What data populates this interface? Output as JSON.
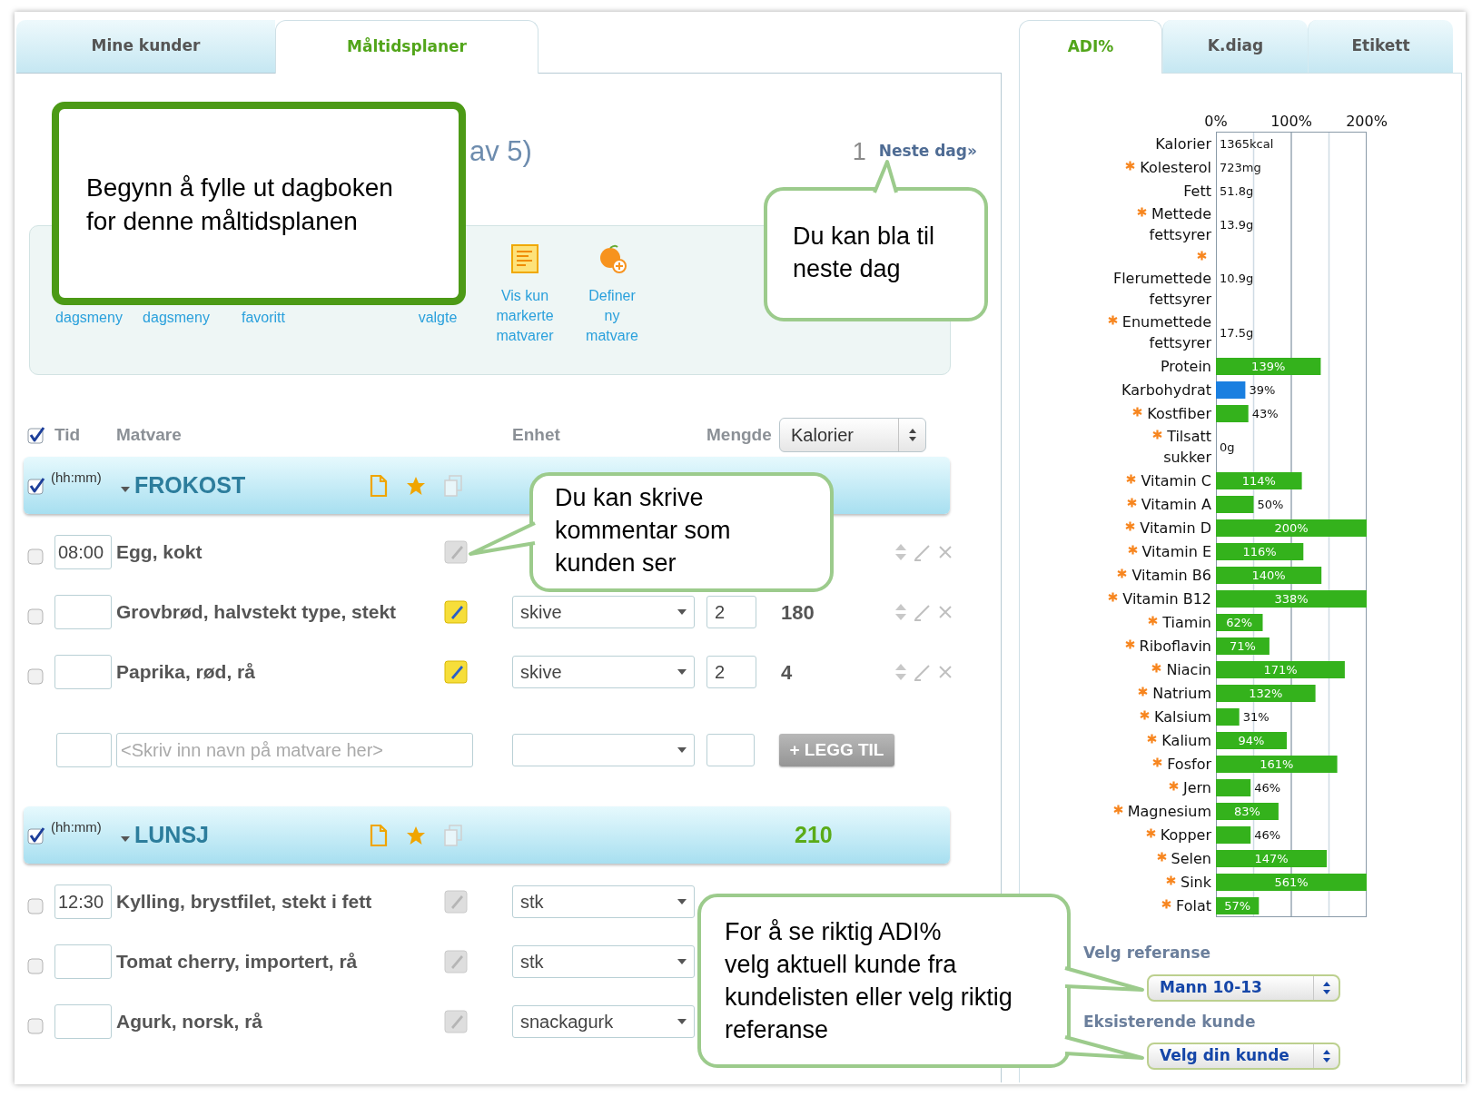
{
  "left_tabs": [
    {
      "label": "Mine kunder",
      "selected": false
    },
    {
      "label": "Måltidsplaner",
      "selected": true
    }
  ],
  "right_tabs": [
    {
      "label": "ADI%",
      "selected": true
    },
    {
      "label": "K.diag",
      "selected": false
    },
    {
      "label": "Etikett",
      "selected": false
    }
  ],
  "day_header": {
    "title": "av 5)",
    "day": "1",
    "next_link": "Neste dag»"
  },
  "toolbar": [
    {
      "kind": "covered",
      "label": "dagsmeny"
    },
    {
      "kind": "covered",
      "label": "dagsmeny"
    },
    {
      "kind": "covered",
      "label": "favoritt"
    },
    {
      "kind": "covered",
      "label": "valgte"
    },
    {
      "kind": "icon",
      "label": "Vis kun\nmarkerte\nmatvarer"
    },
    {
      "kind": "icon",
      "label": "Definer\nny\nmatvare"
    }
  ],
  "table_header": {
    "checked": true,
    "columns": [
      "Tid",
      "Matvare",
      "Enhet",
      "Mengde"
    ],
    "measure": "Kalorier"
  },
  "meals": [
    {
      "checked": true,
      "time_hint": "(hh:mm)",
      "name": "FROKOST",
      "rows": [
        {
          "checked": false,
          "time": "08:00",
          "food": "Egg, kokt",
          "has_comment": false,
          "actions": true
        },
        {
          "checked": false,
          "food": "Grovbrød, halvstekt type, stekt",
          "has_comment": true,
          "unit": "skive",
          "amount": "2",
          "kcal": "180",
          "actions": true
        },
        {
          "checked": false,
          "food": "Paprika, rød, rå",
          "has_comment": true,
          "unit": "skive",
          "amount": "2",
          "kcal": "4",
          "actions": true
        }
      ],
      "add_row": {
        "placeholder": "<Skriv inn navn på matvare her>",
        "button": "+ LEGG TIL",
        "disabled": true
      }
    },
    {
      "checked": true,
      "time_hint": "(hh:mm)",
      "name": "LUNSJ",
      "total": "210",
      "rows": [
        {
          "checked": false,
          "time": "12:30",
          "food": "Kylling, brystfilet, stekt i fett",
          "has_comment": false,
          "unit": "stk",
          "actions": false
        },
        {
          "checked": false,
          "food": "Tomat cherry, importert, rå",
          "has_comment": false,
          "unit": "stk",
          "actions": false
        },
        {
          "checked": false,
          "food": "Agurk, norsk, rå",
          "has_comment": false,
          "unit": "snackagurk",
          "actions": false
        }
      ]
    }
  ],
  "callouts": [
    {
      "kind": "strong",
      "text": "Begynn å fylle ut dagboken\nfor denne måltidsplanen"
    },
    {
      "kind": "soft",
      "text": "Du kan bla til\nneste dag"
    },
    {
      "kind": "soft",
      "text": "Du kan skrive\nkommentar som\nkunden ser"
    },
    {
      "kind": "soft",
      "text": "For å se riktig ADI%\nvelg aktuell kunde fra\nkundelisten eller velg riktig\nreferanse"
    }
  ],
  "adi_chart": {
    "starred": [
      false,
      true,
      false,
      true,
      true,
      true,
      false,
      false,
      true,
      true,
      true,
      true,
      true,
      true,
      true,
      true,
      true,
      true,
      true,
      true,
      true,
      true,
      true,
      true,
      true,
      true,
      true,
      true,
      true
    ],
    "chart_data": {
      "type": "bar",
      "orientation": "horizontal",
      "stacked": true,
      "categories": [
        "Kalorier",
        "Kolesterol",
        "Fett",
        "Mettede fettsyrer",
        "Flerumettede fettsyrer",
        "Enumettede fettsyrer",
        "Protein",
        "Karbohydrat",
        "Kostfiber",
        "Tilsatt sukker",
        "Vitamin C",
        "Vitamin A",
        "Vitamin D",
        "Vitamin E",
        "Vitamin B6",
        "Vitamin B12",
        "Tiamin",
        "Riboflavin",
        "Niacin",
        "Natrium",
        "Kalsium",
        "Kalium",
        "Fosfor",
        "Jern",
        "Magnesium",
        "Kopper",
        "Selen",
        "Sink",
        "Folat"
      ],
      "series": [
        {
          "color": "#34b21c",
          "values": [
            null,
            null,
            null,
            null,
            null,
            null,
            139,
            null,
            43,
            null,
            114,
            50,
            200,
            116,
            140,
            200,
            62,
            71,
            171,
            132,
            31,
            94,
            161,
            46,
            83,
            46,
            147,
            200,
            57
          ]
        },
        {
          "color": "#1a7fe0",
          "values": [
            null,
            null,
            null,
            null,
            null,
            null,
            null,
            39,
            null,
            null,
            null,
            null,
            null,
            null,
            null,
            null,
            null,
            null,
            null,
            null,
            null,
            null,
            null,
            null,
            null,
            null,
            null,
            null,
            null
          ]
        }
      ],
      "value_labels": [
        "1365kcal",
        "723mg",
        "51.8g",
        "13.9g",
        "10.9g",
        "17.5g",
        "139%",
        "39%",
        "43%",
        "0g",
        "114%",
        "50%",
        "200%",
        "116%",
        "140%",
        "338%",
        "62%",
        "71%",
        "171%",
        "132%",
        "31%",
        "94%",
        "161%",
        "46%",
        "83%",
        "46%",
        "147%",
        "561%",
        "57%"
      ],
      "xlim": [
        0,
        200
      ],
      "ref_lines": [
        {
          "axis": "x",
          "value": 50
        },
        {
          "axis": "x",
          "value": 150
        }
      ],
      "xticks": [
        {
          "value": 0,
          "label": "0%"
        },
        {
          "value": 100,
          "label": "100%"
        },
        {
          "value": 200,
          "label": "200%"
        }
      ]
    }
  },
  "reference": {
    "label": "Velg referanse",
    "value": "Mann 10-13"
  },
  "customer": {
    "label": "Eksisterende kunde",
    "value": "Velg din kunde"
  }
}
